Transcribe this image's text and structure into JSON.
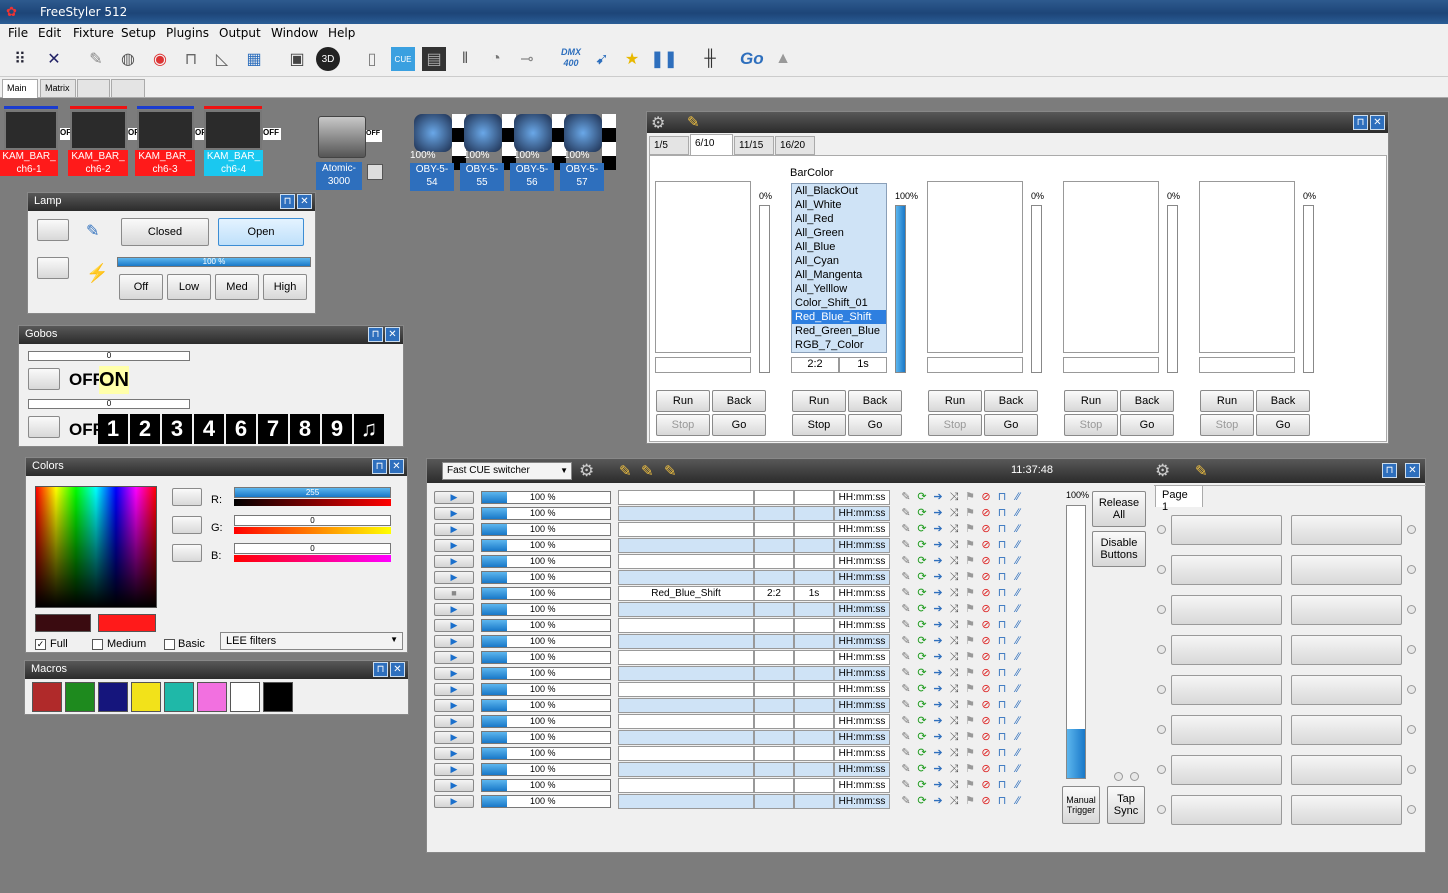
{
  "app": {
    "title": "FreeStyler 512"
  },
  "menu": [
    "File",
    "Edit",
    "Fixture",
    "Setup",
    "Plugins",
    "Output",
    "Window",
    "Help"
  ],
  "toolbar": {
    "go_label": "Go",
    "dmx_label": "DMX",
    "dmx_sub": "400",
    "cue_label": "CUE"
  },
  "tabs": [
    "Main",
    "Matrix",
    "",
    ""
  ],
  "fixtures": [
    {
      "name": "KAM_BAR_ ch6-1",
      "state": "OFF",
      "accent": "#ff1a1a"
    },
    {
      "name": "KAM_BAR_ ch6-2",
      "state": "OFF",
      "accent": "#ff1a1a"
    },
    {
      "name": "KAM_BAR_ ch6-3",
      "state": "OFF",
      "accent": "#ff1a1a"
    },
    {
      "name": "KAM_BAR_ ch6-4",
      "state": "OFF",
      "accent": "#1ac8f0"
    }
  ],
  "atomic": {
    "name": "Atomic- 3000",
    "state": "OFF"
  },
  "moving_heads": [
    {
      "name": "OBY-5- 54",
      "level": "100%"
    },
    {
      "name": "OBY-5- 55",
      "level": "100%"
    },
    {
      "name": "OBY-5- 56",
      "level": "100%"
    },
    {
      "name": "OBY-5- 57",
      "level": "100%"
    }
  ],
  "lamp": {
    "title": "Lamp",
    "closed": "Closed",
    "open": "Open",
    "level": "100 %",
    "level_fraction": 1.0,
    "off": "Off",
    "low": "Low",
    "med": "Med",
    "high": "High"
  },
  "gobos": {
    "title": "Gobos",
    "value1": "0",
    "value2": "0",
    "off_label": "OFF",
    "on_label": "ON",
    "off2_label": "OFF",
    "numbers": [
      "1",
      "2",
      "3",
      "4",
      "6",
      "7",
      "8",
      "9"
    ]
  },
  "colors": {
    "title": "Colors",
    "r_label": "R:",
    "g_label": "G:",
    "b_label": "B:",
    "r_value": "255",
    "g_value": "0",
    "b_value": "0",
    "full": "Full",
    "medium": "Medium",
    "basic": "Basic",
    "filter": "LEE filters"
  },
  "macros": {
    "title": "Macros",
    "swatches": [
      "#b02a2a",
      "#1e8a1e",
      "#15157c",
      "#f2e21a",
      "#1fb8a8",
      "#f270e0",
      "#ffffff",
      "#000000"
    ]
  },
  "sequencer": {
    "pages": [
      "1/5",
      "6/10",
      "11/15",
      "16/20"
    ],
    "active_page": "6/10",
    "slot_title": "BarColor",
    "items": [
      "All_BlackOut",
      "All_White",
      "All_Red",
      "All_Green",
      "All_Blue",
      "All_Cyan",
      "All_Mangenta",
      "All_Yelllow",
      "Color_Shift_01",
      "Red_Blue_Shift",
      "Red_Green_Blue",
      "RGB_7_Color"
    ],
    "selected": "Red_Blue_Shift",
    "slot_timing": [
      "2:2",
      "1s"
    ],
    "levels": [
      "0%",
      "100%",
      "0%",
      "0%",
      "0%"
    ],
    "run": "Run",
    "back": "Back",
    "stop": "Stop",
    "go": "Go"
  },
  "cue": {
    "mode": "Fast CUE switcher",
    "clock": "11:37:48",
    "row_level": "100 %",
    "row_time": "HH:mm:ss",
    "active_row": {
      "index": 6,
      "name": "Red_Blue_Shift",
      "timing": "2:2",
      "fade": "1s"
    },
    "master": "100%",
    "master_fraction": 0.18,
    "release_all": "Release All",
    "disable_buttons": "Disable Buttons",
    "manual_trigger": "Manual Trigger",
    "tap_sync": "Tap Sync",
    "page_tab": "Page 1"
  },
  "colors_map": {
    "accent": "#2e6fbd",
    "window_bg": "#7c7c7c",
    "title_dark": "#2b2b2b"
  }
}
